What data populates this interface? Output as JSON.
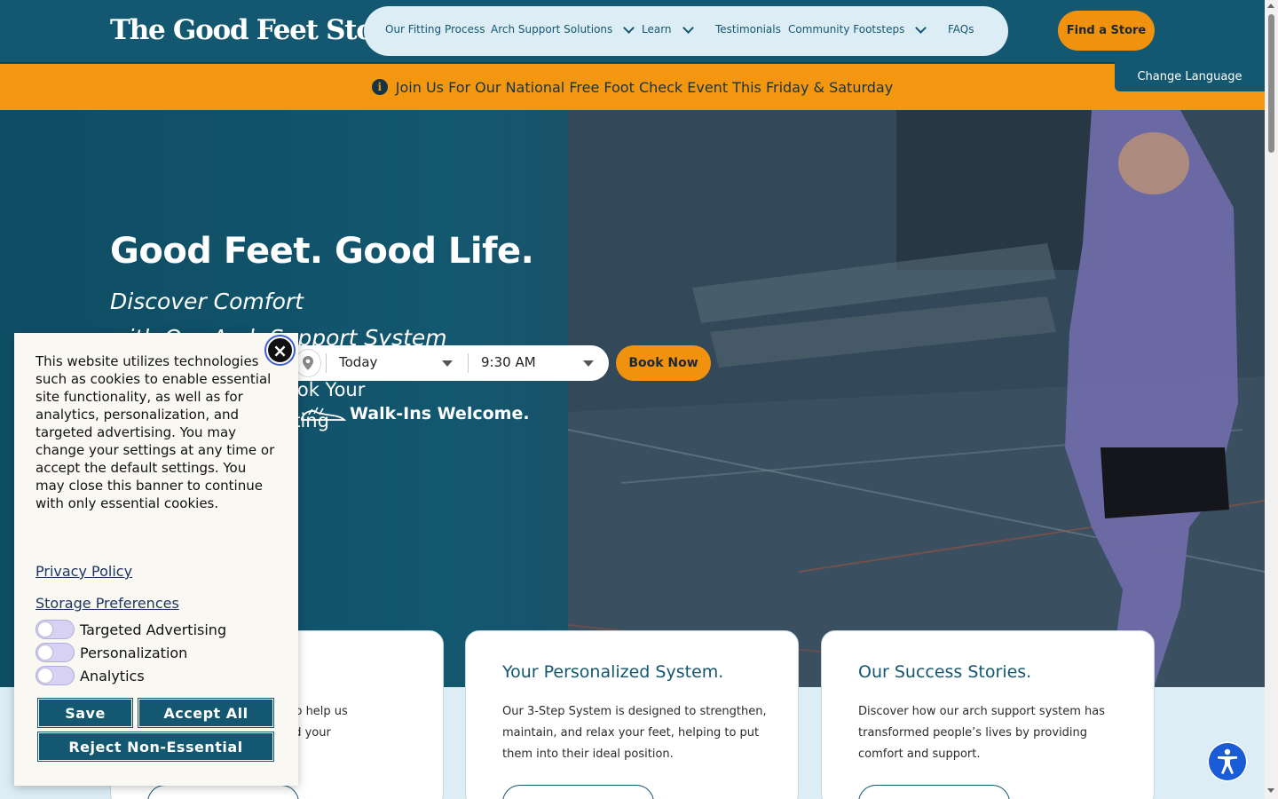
{
  "header": {
    "logo": "The Good Feet Store",
    "logo_mark": "®",
    "nav": [
      {
        "label": "Our Fitting Process",
        "dropdown": false
      },
      {
        "label": "Arch Support Solutions",
        "dropdown": true
      },
      {
        "label": "Learn",
        "dropdown": true
      },
      {
        "label": "Testimonials",
        "dropdown": false
      },
      {
        "label": "Community Footsteps",
        "dropdown": true
      },
      {
        "label": "FAQs",
        "dropdown": false
      }
    ],
    "find_store": "Find a Store"
  },
  "announcement": {
    "text": "Join Us For Our National Free Foot Check Event This Friday & Saturday",
    "change_language": "Change Language"
  },
  "hero": {
    "title": "Good Feet. Good Life.",
    "subtitle_line1": "Discover Comfort",
    "subtitle_line2": "with Our Arch Support System",
    "book_line1": "ook Your",
    "book_line2": "tting",
    "date_value": "Today",
    "time_value": "9:30 AM",
    "book_now": "Book Now",
    "walkins": "Walk-Ins Welcome."
  },
  "cards": [
    {
      "title": "",
      "text": "d to help us\nand your"
    },
    {
      "title": "Your Personalized System.",
      "text": "Our 3-Step System is designed to strengthen, maintain, and relax your feet, helping to put them into their ideal position."
    },
    {
      "title": "Our Success Stories.",
      "text": "Discover how our arch support system has transformed people’s lives by providing comfort and support."
    }
  ],
  "cookie": {
    "body": "This website utilizes technologies such as cookies to enable essential site functionality, as well as for analytics, personalization, and targeted advertising. You may change your settings at any time or accept the default settings. You may close this banner to continue with only essential cookies.",
    "privacy_policy": "Privacy Policy",
    "storage_preferences": "Storage Preferences",
    "prefs": [
      "Targeted Advertising",
      "Personalization",
      "Analytics"
    ],
    "save": "Save",
    "accept_all": "Accept All",
    "reject": "Reject Non-Essential",
    "close_glyph": "×"
  },
  "colors": {
    "brand_teal": "#145770",
    "accent_orange": "#f0920e",
    "light_blue": "#dcedf5"
  }
}
